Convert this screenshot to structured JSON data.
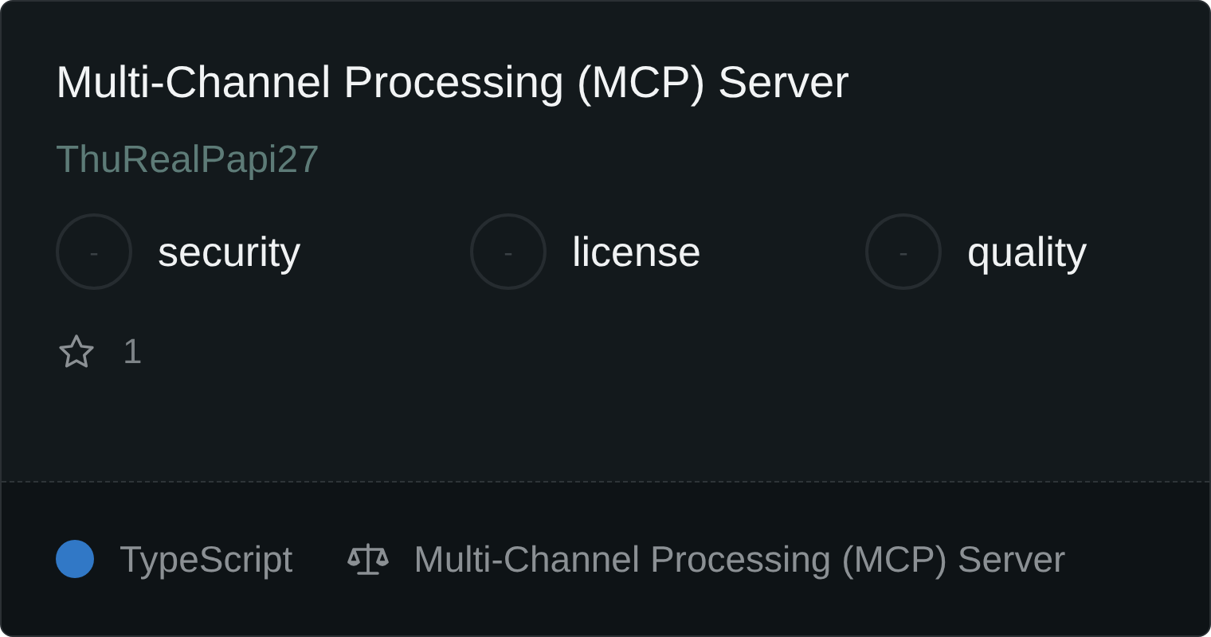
{
  "title": "Multi-Channel Processing (MCP) Server",
  "author": "ThuRealPapi27",
  "scores": [
    {
      "value": "-",
      "label": "security"
    },
    {
      "value": "-",
      "label": "license"
    },
    {
      "value": "-",
      "label": "quality"
    }
  ],
  "stars": "1",
  "language": {
    "name": "TypeScript",
    "color": "#3178c6"
  },
  "license": "Multi-Channel Processing (MCP) Server"
}
